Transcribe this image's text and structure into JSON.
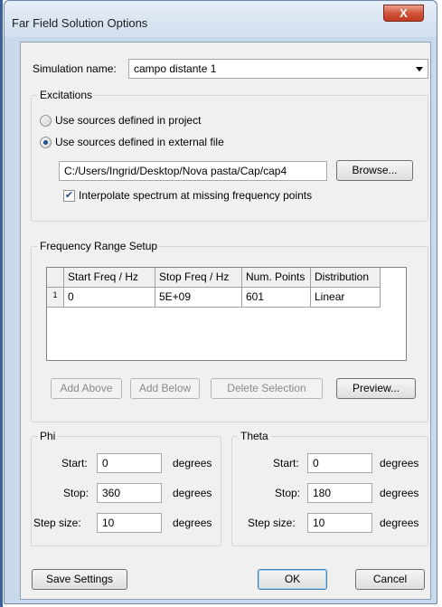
{
  "window": {
    "title": "Far Field Solution Options",
    "close_label": "X"
  },
  "simulation": {
    "label": "Simulation name:",
    "value": "campo distante 1"
  },
  "excitations": {
    "legend": "Excitations",
    "option_project": "Use sources defined in project",
    "option_external": "Use sources defined in external file",
    "selected": "external",
    "file_path": "C:/Users/Ingrid/Desktop/Nova pasta/Cap/cap4",
    "browse_label": "Browse...",
    "interpolate_label": "Interpolate spectrum at missing frequency points",
    "interpolate_checked": true
  },
  "frequency": {
    "legend": "Frequency Range Setup",
    "columns": [
      "Start Freq / Hz",
      "Stop Freq / Hz",
      "Num. Points",
      "Distribution"
    ],
    "rows": [
      {
        "index": "1",
        "cells": [
          "0",
          "5E+09",
          "601",
          "Linear"
        ]
      }
    ],
    "add_above_label": "Add Above",
    "add_below_label": "Add Below",
    "delete_label": "Delete Selection",
    "preview_label": "Preview..."
  },
  "phi": {
    "legend": "Phi",
    "start_label": "Start:",
    "start_value": "0",
    "stop_label": "Stop:",
    "stop_value": "360",
    "step_label": "Step size:",
    "step_value": "10",
    "unit": "degrees"
  },
  "theta": {
    "legend": "Theta",
    "start_label": "Start:",
    "start_value": "0",
    "stop_label": "Stop:",
    "stop_value": "180",
    "step_label": "Step size:",
    "step_value": "10",
    "unit": "degrees"
  },
  "footer": {
    "save_label": "Save Settings",
    "ok_label": "OK",
    "cancel_label": "Cancel"
  }
}
